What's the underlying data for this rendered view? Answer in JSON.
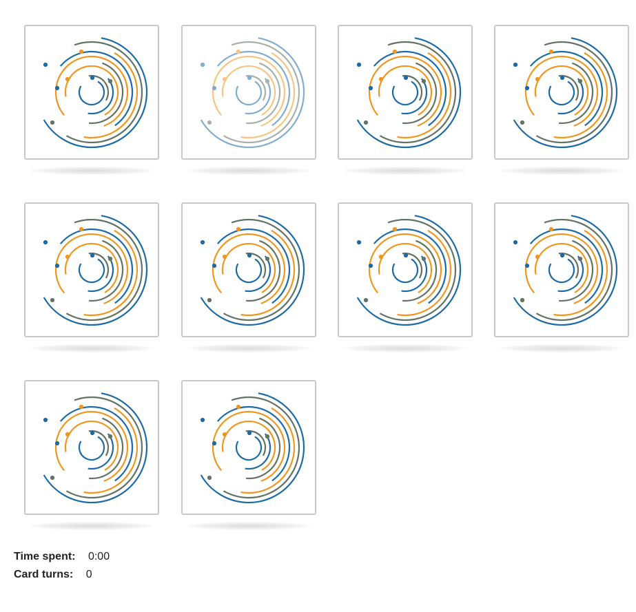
{
  "colors": {
    "blue": "#1a6aa8",
    "orange": "#f0961e",
    "gray": "#627264",
    "card_border": "#c8c8c8"
  },
  "cards": [
    {
      "state": "face-down"
    },
    {
      "state": "face-down-faded"
    },
    {
      "state": "face-down"
    },
    {
      "state": "face-down"
    },
    {
      "state": "face-down"
    },
    {
      "state": "face-down"
    },
    {
      "state": "face-down"
    },
    {
      "state": "face-down"
    },
    {
      "state": "face-down"
    },
    {
      "state": "face-down"
    }
  ],
  "card_back_icon": "concentric-spiral-arcs-icon",
  "stats": {
    "time_label": "Time spent:",
    "time_value": "0:00",
    "turns_label": "Card turns:",
    "turns_value": "0"
  }
}
